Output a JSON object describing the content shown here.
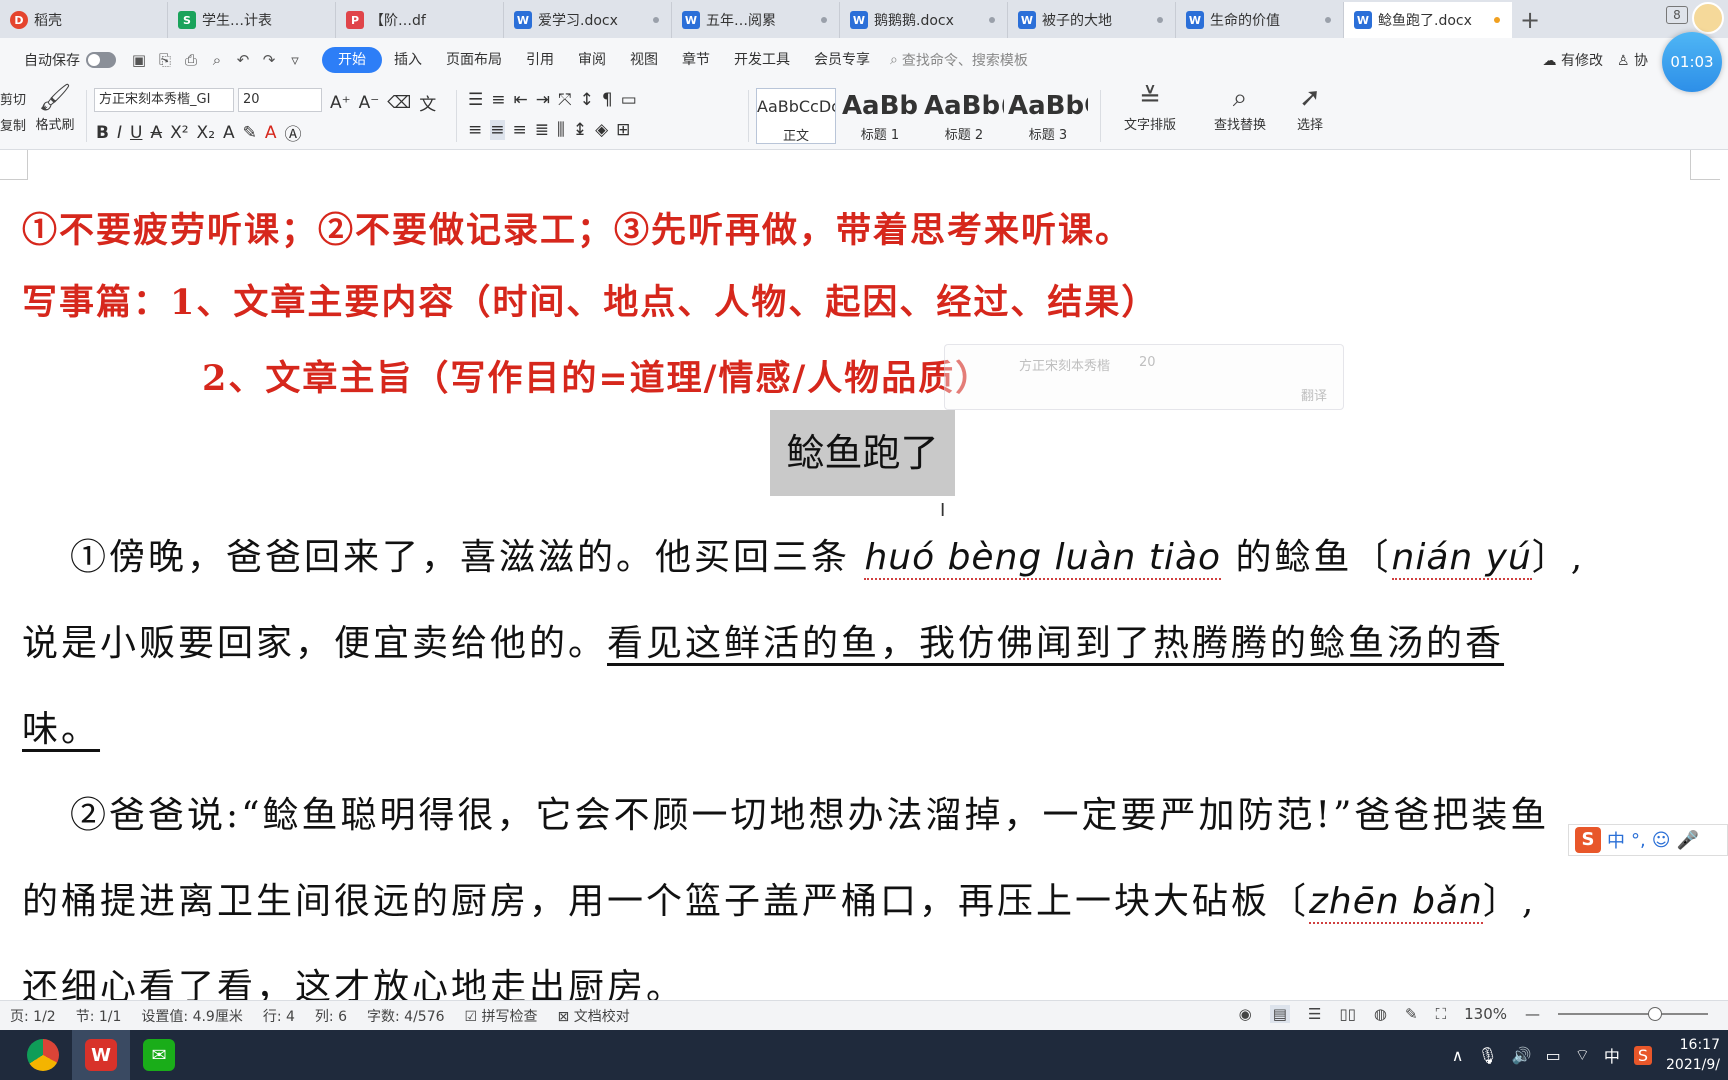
{
  "tabs": [
    {
      "label": "稻壳",
      "icon": "daoke-icon",
      "type": "d"
    },
    {
      "label": "学生…计表",
      "icon": "sheet-icon",
      "type": "s"
    },
    {
      "label": "【阶…df",
      "icon": "pdf-icon",
      "type": "p"
    },
    {
      "label": "爱学习.docx",
      "icon": "word-icon",
      "type": "w"
    },
    {
      "label": "五年…阅累",
      "icon": "word-icon",
      "type": "w"
    },
    {
      "label": "鹅鹅鹅.docx",
      "icon": "word-icon",
      "type": "w"
    },
    {
      "label": "被子的大地",
      "icon": "word-icon",
      "type": "w"
    },
    {
      "label": "生命的价值",
      "icon": "word-icon",
      "type": "w"
    },
    {
      "label": "鲶鱼跑了.docx",
      "icon": "word-icon",
      "type": "w"
    }
  ],
  "tab_add": "+",
  "tab_count": "8",
  "menu": {
    "autosave": "自动保存",
    "items": [
      "开始",
      "插入",
      "页面布局",
      "引用",
      "审阅",
      "视图",
      "章节",
      "开发工具",
      "会员专享"
    ],
    "search_placeholder": "查找命令、搜索模板",
    "has_changes": "有修改",
    "collab": "协"
  },
  "timer": "01:03",
  "ribbon": {
    "cut": "剪切",
    "copy": "复制",
    "format_painter": "格式刷",
    "font_name": "方正宋刻本秀楷_GI",
    "font_size": "20",
    "styles": [
      {
        "sample": "AaBbCcDc",
        "label": "正文"
      },
      {
        "sample": "AaBb",
        "label": "标题 1"
      },
      {
        "sample": "AaBb(",
        "label": "标题 2"
      },
      {
        "sample": "AaBbC",
        "label": "标题 3"
      }
    ],
    "text_layout": "文字排版",
    "find_replace": "查找替换",
    "select": "选择"
  },
  "document": {
    "red_line1": "①不要疲劳听课；②不要做记录工；③先听再做，带着思考来听课。",
    "red_line2": "写事篇：1、文章主要内容（时间、地点、人物、起因、经过、结果）",
    "red_line3": "2、文章主旨（写作目的=道理/情感/人物品质）",
    "title": "鲶鱼跑了",
    "p1_a": "①傍晚，爸爸回来了，喜滋滋的。他买回三条",
    "p1_pinyin1": "huó bèng luàn tiào",
    "p1_b": "的鲶鱼〔",
    "p1_pinyin2": "nián yú",
    "p1_c": "〕,",
    "p2_a": "说是小贩要回家，便宜卖给他的。",
    "p2_b": "看见这鲜活的鱼，我仿佛闻到了热腾腾的鲶鱼汤的香",
    "p3": "味。",
    "p4": "②爸爸说:“鲶鱼聪明得很，它会不顾一切地想办法溜掉，一定要严加防范!”爸爸把装鱼",
    "p5_a": "的桶提进离卫生间很远的厨房，用一个篮子盖严桶口，再压上一块大砧板〔",
    "p5_pinyin": "zhēn bǎn",
    "p5_b": "〕,",
    "p6": "还细心看了看，这才放心地走出厨房。"
  },
  "float_toolbar": {
    "font": "方正宋刻本秀楷",
    "size": "20",
    "translate": "翻译"
  },
  "ime": "中",
  "status": {
    "page": "页: 1/2",
    "section": "节: 1/1",
    "setting": "设置值: 4.9厘米",
    "row": "行: 4",
    "col": "列: 6",
    "words": "字数: 4/576",
    "spell": "拼写检查",
    "proof": "文档校对",
    "zoom": "130%"
  },
  "taskbar": {
    "apps": [
      "file-explorer-icon",
      "chrome-icon",
      "wps-icon",
      "wechat-icon"
    ],
    "ime": "中",
    "time": "16:17",
    "date": "2021/9/"
  }
}
